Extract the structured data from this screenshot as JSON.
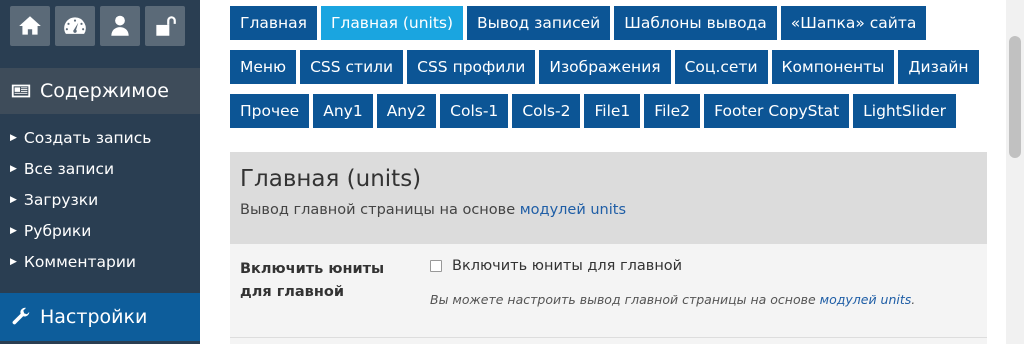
{
  "sidebar": {
    "icons": [
      "home-icon",
      "dashboard-icon",
      "user-icon",
      "unlock-icon"
    ],
    "content_header": "Содержимое",
    "menu": [
      "Создать запись",
      "Все записи",
      "Загрузки",
      "Рубрики",
      "Комментарии"
    ],
    "settings_header": "Настройки"
  },
  "tabs": [
    "Главная",
    "Главная (units)",
    "Вывод записей",
    "Шаблоны вывода",
    "«Шапка» сайта",
    "Меню",
    "CSS стили",
    "CSS профили",
    "Изображения",
    "Соц.сети",
    "Компоненты",
    "Дизайн",
    "Прочее",
    "Any1",
    "Any2",
    "Cols-1",
    "Cols-2",
    "File1",
    "File2",
    "Footer CopyStat",
    "LightSlider"
  ],
  "active_tab": "Главная (units)",
  "panel": {
    "title": "Главная (units)",
    "desc_prefix": "Вывод главной страницы на основе ",
    "desc_link": "модулей units"
  },
  "option": {
    "label": "Включить юниты для главной",
    "checkbox_label": "Включить юниты для главной",
    "checked": false,
    "note_prefix": "Вы можете настроить вывод главной страницы на основе ",
    "note_link": "модулей units",
    "note_suffix": "."
  },
  "colors": {
    "sidebar_bg": "#2a3e52",
    "tab_bg": "#0c5595",
    "tab_active_bg": "#1aa5e0",
    "settings_bg": "#0d5d9b",
    "link": "#1f5ea6"
  }
}
